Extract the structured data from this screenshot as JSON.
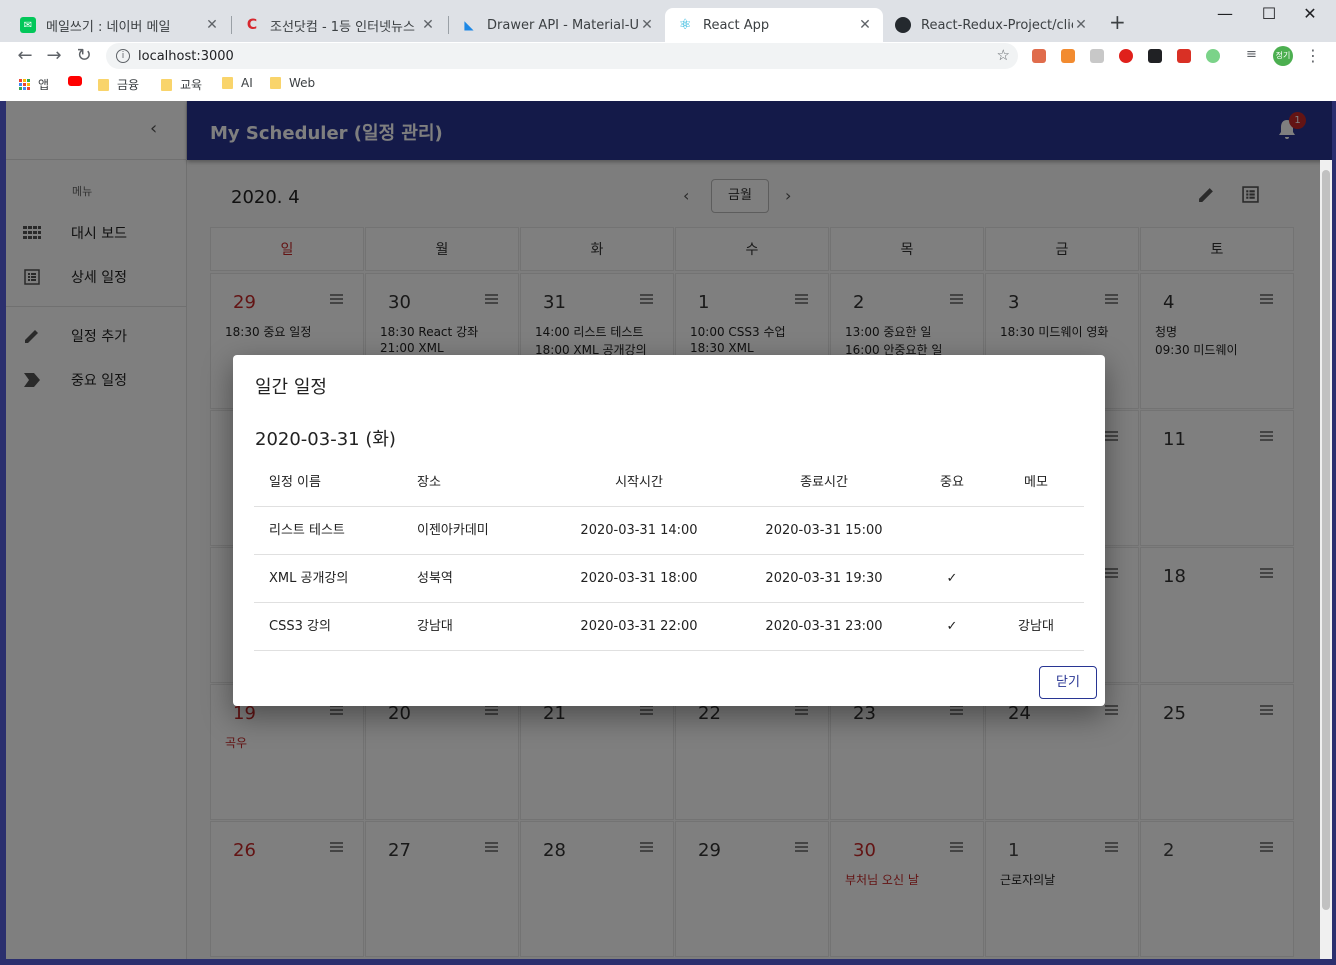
{
  "browser": {
    "tabs": [
      {
        "title": "메일쓰기 : 네이버 메일",
        "favicon_color": "#03c75a"
      },
      {
        "title": "조선닷컴 - 1등 인터넷뉴스",
        "favicon_color": "#d7282f"
      },
      {
        "title": "Drawer API - Material-UI",
        "favicon_color": "#1e88e5"
      },
      {
        "title": "React App",
        "favicon_color": "#61dafb"
      },
      {
        "title": "React-Redux-Project/client/",
        "favicon_color": "#24292e"
      }
    ],
    "url": "localhost:3000",
    "bookmarks": [
      {
        "label": "앱"
      },
      {
        "label": ""
      },
      {
        "label": "금융"
      },
      {
        "label": "교육"
      },
      {
        "label": "AI"
      },
      {
        "label": "Web"
      }
    ],
    "profile_label": "정기"
  },
  "app": {
    "title": "My Scheduler (일정 관리)",
    "notification_count": "1",
    "accent_color": "#283593",
    "drawer": {
      "caption": "메뉴",
      "items": [
        {
          "label": "대시 보드",
          "icon": "apps-grid-icon"
        },
        {
          "label": "상세 일정",
          "icon": "list-view-icon"
        },
        {
          "label": "일정 추가",
          "icon": "pencil-icon"
        },
        {
          "label": "중요 일정",
          "icon": "label-icon"
        }
      ]
    },
    "calendar": {
      "month_label": "2020. 4",
      "today_label": "금월",
      "weekdays": [
        "일",
        "월",
        "화",
        "수",
        "목",
        "금",
        "토"
      ],
      "weeks": [
        [
          {
            "day": "29",
            "events": [
              "18:30 중요 일정"
            ]
          },
          {
            "day": "30",
            "events": [
              "18:30 React 강좌",
              "21:00 XML"
            ]
          },
          {
            "day": "31",
            "events": [
              "14:00 리스트 테스트",
              "18:00 XML 공개강의"
            ]
          },
          {
            "day": "1",
            "events": [
              "10:00 CSS3 수업",
              "18:30 XML"
            ]
          },
          {
            "day": "2",
            "events": [
              "13:00 중요한 일",
              "16:00 안중요한 일"
            ]
          },
          {
            "day": "3",
            "events": [
              "18:30 미드웨이 영화"
            ]
          },
          {
            "day": "4",
            "events": [
              "청명",
              "09:30 미드웨이"
            ]
          }
        ],
        [
          {
            "day": "",
            "events": []
          },
          {
            "day": "",
            "events": []
          },
          {
            "day": "",
            "events": []
          },
          {
            "day": "",
            "events": []
          },
          {
            "day": "",
            "events": []
          },
          {
            "day": "",
            "events": []
          },
          {
            "day": "11",
            "events": []
          }
        ],
        [
          {
            "day": "",
            "events": []
          },
          {
            "day": "",
            "events": []
          },
          {
            "day": "",
            "events": []
          },
          {
            "day": "",
            "events": []
          },
          {
            "day": "",
            "events": []
          },
          {
            "day": "",
            "events": []
          },
          {
            "day": "18",
            "events": []
          }
        ],
        [
          {
            "day": "19",
            "events": [
              "곡우"
            ]
          },
          {
            "day": "20",
            "events": []
          },
          {
            "day": "21",
            "events": []
          },
          {
            "day": "22",
            "events": []
          },
          {
            "day": "23",
            "events": []
          },
          {
            "day": "24",
            "events": []
          },
          {
            "day": "25",
            "events": []
          }
        ],
        [
          {
            "day": "26",
            "events": []
          },
          {
            "day": "27",
            "events": []
          },
          {
            "day": "28",
            "events": []
          },
          {
            "day": "29",
            "events": []
          },
          {
            "day": "30",
            "events": [
              "부처님 오신 날"
            ]
          },
          {
            "day": "1",
            "events": [
              "근로자의날"
            ]
          },
          {
            "day": "2",
            "events": []
          }
        ]
      ]
    }
  },
  "dialog": {
    "title": "일간 일정",
    "date": "2020-03-31 (화)",
    "columns": [
      "일정 이름",
      "장소",
      "시작시간",
      "종료시간",
      "중요",
      "메모"
    ],
    "rows": [
      [
        "리스트 테스트",
        "이젠아카데미",
        "2020-03-31 14:00",
        "2020-03-31 15:00",
        "",
        ""
      ],
      [
        "XML 공개강의",
        "성북역",
        "2020-03-31 18:00",
        "2020-03-31 19:30",
        "✓",
        ""
      ],
      [
        "CSS3 강의",
        "강남대",
        "2020-03-31 22:00",
        "2020-03-31 23:00",
        "✓",
        "강남대"
      ]
    ],
    "close_label": "닫기"
  }
}
